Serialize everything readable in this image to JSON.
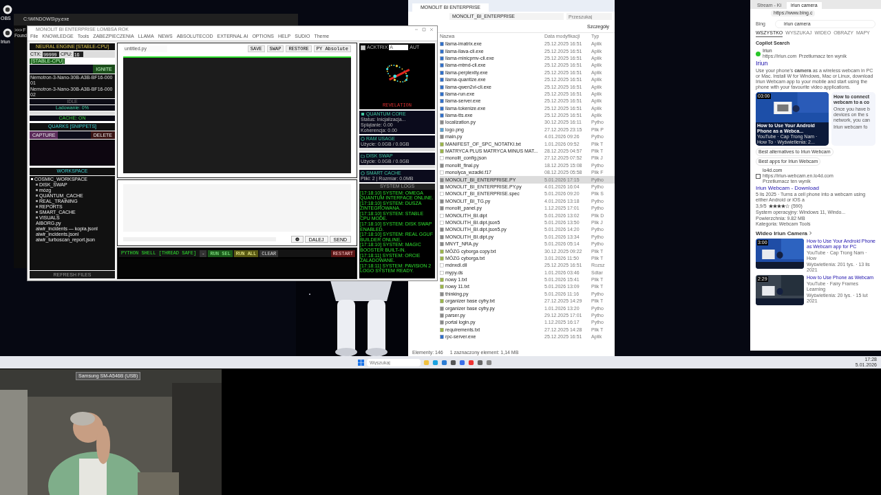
{
  "desktop_icons": [
    {
      "label": "OBS"
    },
    {
      "label": "Iriun"
    }
  ],
  "terminal": {
    "title": "C:\\WINDOWS\\py.exe",
    "lines": [
      ">>> F",
      "Found"
    ]
  },
  "app": {
    "title": "MONOLIT BI ENTERPRISE LOMBSA ROK",
    "menu": [
      "File",
      "KNOWLEDGE",
      "Tools",
      "ZABEZPIECZENIA",
      "LLAMA",
      "NEWS",
      "ABSOLUTECOD",
      "EXTERNAL AI",
      "OPTIONS",
      "HELP",
      "SUDIO",
      "Theme"
    ],
    "engine": {
      "title": "NEURAL ENGINE [STABLE-CPU]",
      "ctx_label": "CTX:",
      "ctx": "99999",
      "cpu_label": "CPU:",
      "cpu": "16",
      "mode": "[STABLE-CPU]",
      "ignite": "IGNITE",
      "models": [
        "Nemotron-3-Nano-30B-A3B-BF16-00001",
        "Nemotron-3-Nano-30B-A3B-BF16-00002"
      ],
      "status": "IDLE",
      "loading": "Ladowanie: 0%",
      "level": 0,
      "cache": "CACHE: ON"
    },
    "quarks": {
      "title": "QUARKS [SNIPPETS]",
      "capture": "CAPTURE",
      "delete": "DELETE"
    },
    "workspace": {
      "title": "WORKSPACE",
      "refresh": "REFRESH FILES",
      "tree": [
        {
          "label": "COSMIC_WORKSPACE",
          "kind": "folder",
          "expanded": true,
          "children": [
            {
              "label": "DISK_SWAP",
              "kind": "folder",
              "expanded": false
            },
            {
              "label": "mózg",
              "kind": "folder",
              "expanded": false
            },
            {
              "label": "QUANTUM_CACHE",
              "kind": "folder",
              "expanded": false
            },
            {
              "label": "REAL_TRAINING",
              "kind": "folder",
              "expanded": false
            },
            {
              "label": "REPORTS",
              "kind": "folder",
              "expanded": false
            },
            {
              "label": "SMART_CACHE",
              "kind": "folder",
              "expanded": false
            },
            {
              "label": "VISUALS",
              "kind": "folder",
              "expanded": false
            },
            {
              "label": "AIBORG.py",
              "kind": "file"
            },
            {
              "label": "aiwir_incidents — kopia.jsonl",
              "kind": "file"
            },
            {
              "label": "aiwir_incidents.jsonl",
              "kind": "file"
            },
            {
              "label": "aiwir_turboscan_report.json",
              "kind": "file"
            }
          ]
        }
      ]
    },
    "editor": {
      "filename": "untitled.py",
      "buttons": [
        "SAVE",
        "SWAP",
        "RESTORE",
        "PY Absolute"
      ]
    },
    "chat": {
      "buttons": [
        "DALEJ",
        "SEND"
      ]
    },
    "shell": {
      "title": "PYTHON SHELL [THREAD SAFE]",
      "buttons": [
        {
          "label": "-",
          "kind": "plain"
        },
        {
          "label": "RUN SEL",
          "kind": "green"
        },
        {
          "label": "RUN ALL",
          "kind": "olive"
        },
        {
          "label": "CLEAR",
          "kind": "plain"
        },
        {
          "label": "RESTART",
          "kind": "red"
        }
      ]
    },
    "visual": {
      "checkbox": {
        "label": "ACKTRIX",
        "checked": true
      },
      "select": "A",
      "auto": "AUT",
      "caption": "REVELATION"
    },
    "cards": [
      {
        "kind": "chip",
        "title": "QUANTUM CORE",
        "lines": [
          "Status: Inicjalizacja...",
          "Splątanie: 0.00",
          "Koherencja: 0.00"
        ]
      },
      {
        "kind": "gauge",
        "title": "RAM USAGE",
        "lines": [
          "Użycie: 0.0GB / 0.0GB"
        ],
        "level": 0
      },
      {
        "kind": "folder",
        "title": "DISK SWAP",
        "lines": [
          "Użycie: 0.0GB / 0.0GB"
        ],
        "level": 0
      },
      {
        "kind": "gauge",
        "title": "SMART CACHE",
        "lines": [
          "Pliki: 2 | Rozmiar: 0.0MB"
        ]
      }
    ],
    "logs": {
      "title": "SYSTEM LOGS",
      "lines": [
        "[17:18:10] SYSTEM: OMEGA QUANTUM INTERFACE ONLINE.",
        "[17:18:10] SYSTEM: DUSZA ZINTEGROWANA.",
        "[17:18:10] SYSTEM: STABLE CPU MODE.",
        "[17:18:10] SYSTEM: DISK SWAP ENABLED.",
        "[17:18:10] SYSTEM: REAL GGUF BUILDER ONLINE.",
        "[17:18:10] SYSTEM: MAGIC BOOSTER BUILT-IN.",
        "[17:18:11] SYSTEM: ORCIE ZALADOWANE.",
        "[17:18:11] SYSTEM: PAVISION 2 LOGO SYSTEM READY."
      ]
    }
  },
  "explorer": {
    "tab": "MONOLIT BI ENTERPRISE",
    "path": "MONOLIT_BI_ENTERPRISE",
    "search": {
      "placeholder": "Przeszukaj"
    },
    "view": "Szczegóły",
    "columns": [
      "Nazwa",
      "Data modyfikacji",
      "Typ"
    ],
    "rows": [
      {
        "name": "llama-imatrix.exe",
        "date": "25.12.2025 16:51",
        "type": "Aplik",
        "kind": "exe",
        "selected": false
      },
      {
        "name": "llama-llava-cli.exe",
        "date": "25.12.2025 16:51",
        "type": "Aplik",
        "kind": "exe",
        "selected": false
      },
      {
        "name": "llama-minicpmv-cli.exe",
        "date": "25.12.2025 16:51",
        "type": "Aplik",
        "kind": "exe",
        "selected": false
      },
      {
        "name": "llama-mtmd-cli.exe",
        "date": "25.12.2025 16:51",
        "type": "Aplik",
        "kind": "exe",
        "selected": false
      },
      {
        "name": "llama-perplexity.exe",
        "date": "25.12.2025 16:51",
        "type": "Aplik",
        "kind": "exe",
        "selected": false
      },
      {
        "name": "llama-quantize.exe",
        "date": "25.12.2025 16:51",
        "type": "Aplik",
        "kind": "exe",
        "selected": false
      },
      {
        "name": "llama-qwen2vl-cli.exe",
        "date": "25.12.2025 16:51",
        "type": "Aplik",
        "kind": "exe",
        "selected": false
      },
      {
        "name": "llama-run.exe",
        "date": "25.12.2025 16:51",
        "type": "Aplik",
        "kind": "exe",
        "selected": false
      },
      {
        "name": "llama-server.exe",
        "date": "25.12.2025 16:51",
        "type": "Aplik",
        "kind": "exe",
        "selected": false
      },
      {
        "name": "llama-tokenize.exe",
        "date": "25.12.2025 16:51",
        "type": "Aplik",
        "kind": "exe",
        "selected": false
      },
      {
        "name": "llama-tts.exe",
        "date": "25.12.2025 16:51",
        "type": "Aplik",
        "kind": "exe",
        "selected": false
      },
      {
        "name": "localization.py",
        "date": "30.12.2025 16:11",
        "type": "Pytho",
        "kind": "py",
        "selected": false
      },
      {
        "name": "logo.png",
        "date": "27.12.2025 23:15",
        "type": "Plik P",
        "selected": false
      },
      {
        "name": "main.py",
        "date": "4.01.2026 09:26",
        "type": "Pytho",
        "kind": "py",
        "selected": false
      },
      {
        "name": "MANIFEST_OF_SPC_NOTATKI.txt",
        "date": "1.01.2026 09:52",
        "type": "Plik T",
        "kind": "txt",
        "selected": false
      },
      {
        "name": "MATRYCA PLUS MATRYCA MINUS MAT...",
        "date": "28.12.2025 04:57",
        "type": "Plik T",
        "kind": "txt",
        "selected": false
      },
      {
        "name": "monolit_config.json",
        "date": "27.12.2025 07:52",
        "type": "Plik J",
        "kind": "file",
        "selected": false
      },
      {
        "name": "monolit_final.py",
        "date": "18.12.2025 15:08",
        "type": "Pytho",
        "kind": "py",
        "selected": false
      },
      {
        "name": "monolyca_wzadki.f17",
        "date": "08.12.2025 05:58",
        "type": "Plik F",
        "kind": "file",
        "selected": false
      },
      {
        "name": "MONOLIT_BI_ENTERPRISE.PY",
        "date": "5.01.2026 17:15",
        "type": "Pytho",
        "kind": "py",
        "selected": true
      },
      {
        "name": "MONOLIT_BI_ENTERPRISE.PY.py",
        "date": "4.01.2026 16:04",
        "type": "Pytho",
        "kind": "py",
        "selected": false
      },
      {
        "name": "MONOLIT_BI_ENTERPRISE.spec",
        "date": "5.01.2026 09:20",
        "type": "Plik S",
        "kind": "file",
        "selected": false
      },
      {
        "name": "MONOLIT_BI_TG.py",
        "date": "4.01.2026 13:18",
        "type": "Pytho",
        "kind": "py",
        "selected": false
      },
      {
        "name": "monolit_panel.py",
        "date": "1.12.2025 17:01",
        "type": "Pytho",
        "kind": "py",
        "selected": false
      },
      {
        "name": "MONOLITH_BI.dipt",
        "date": "5.01.2026 13:02",
        "type": "Plik D",
        "kind": "file",
        "selected": false
      },
      {
        "name": "MONOLITH_BI.dipt.json5",
        "date": "5.01.2026 13:50",
        "type": "Plik J",
        "kind": "file",
        "selected": false
      },
      {
        "name": "MONOLITH_BI.dipt.json5.py",
        "date": "5.01.2026 14:20",
        "type": "Pytho",
        "kind": "py",
        "selected": false
      },
      {
        "name": "MONOLITH_BI.dipt.py",
        "date": "5.01.2026 13:34",
        "type": "Pytho",
        "kind": "py",
        "selected": false
      },
      {
        "name": "MNYT_NRA.py",
        "date": "5.01.2026 05:14",
        "type": "Pytho",
        "kind": "py",
        "selected": false
      },
      {
        "name": "MÓZG cyborga copy.txt",
        "date": "30.12.2025 09:22",
        "type": "Plik T",
        "kind": "txt",
        "selected": false
      },
      {
        "name": "MÓZG cyborga.txt",
        "date": "3.01.2026 11:50",
        "type": "Plik T",
        "kind": "txt",
        "selected": false
      },
      {
        "name": "mdnxdl.dll",
        "date": "25.12.2025 16:51",
        "type": "Rozsz",
        "kind": "file",
        "selected": false
      },
      {
        "name": "mypy.ds",
        "date": "1.01.2026 03:46",
        "type": "Sdtar",
        "kind": "file",
        "selected": false
      },
      {
        "name": "nowy 1.txt",
        "date": "5.01.2026 15:41",
        "type": "Plik T",
        "kind": "txt",
        "selected": false
      },
      {
        "name": "nowy 11.txt",
        "date": "5.01.2026 13:09",
        "type": "Plik T",
        "kind": "txt",
        "selected": false
      },
      {
        "name": "thinking.py",
        "date": "5.01.2026 11:16",
        "type": "Pytho",
        "kind": "py",
        "selected": false
      },
      {
        "name": "organizer base cyfry.txt",
        "date": "27.12.2025 14:29",
        "type": "Plik T",
        "kind": "txt",
        "selected": false
      },
      {
        "name": "organizer base cyfry.py",
        "date": "1.01.2026 13:20",
        "type": "Pytho",
        "kind": "py",
        "selected": false
      },
      {
        "name": "parser.py",
        "date": "29.12.2025 17:01",
        "type": "Pytho",
        "kind": "py",
        "selected": false
      },
      {
        "name": "portal login.py",
        "date": "1.12.2025 16:17",
        "type": "Pytho",
        "kind": "py",
        "selected": false
      },
      {
        "name": "requirements.txt",
        "date": "27.12.2025 14:28",
        "type": "Plik T",
        "kind": "txt",
        "selected": false
      },
      {
        "name": "rpc-server.exe",
        "date": "25.12.2025 16:51",
        "type": "Aplik",
        "kind": "exe",
        "selected": false
      }
    ],
    "status": [
      "Elementy: 146",
      "1 zaznaczony element: 1,14 MB"
    ]
  },
  "browser": {
    "tabs": [
      {
        "label": "Stream - Ki",
        "selected": false
      },
      {
        "label": "iriun camera",
        "selected": true
      }
    ],
    "url": "https://www.bing.c",
    "engine": "Bing",
    "query": "iriun camera",
    "nav": [
      {
        "label": "WSZYSTKO",
        "selected": true
      },
      {
        "label": "WYSZUKAJ",
        "selected": false
      },
      {
        "label": "WIDEO",
        "selected": false
      },
      {
        "label": "OBRAZY",
        "selected": false
      },
      {
        "label": "MAPY",
        "selected": false
      }
    ],
    "copilot": "Copilot Search",
    "result1": {
      "site": "Iriun",
      "url": "https://iriun.com",
      "translate": "Przetłumacz ten wynik",
      "title": "Iriun",
      "snippet": "Use your phone's **camera** as a wireless webcam in PC or Mac. Install W for Windows, Mac or Linux, download Iriun Webcam app to your mobile and start using the phone with your favourite video applications."
    },
    "video": {
      "duration": "03:00",
      "caption": "How to Use Your Android Phone as a Webca...",
      "source": "YouTube · Cap Trong Nam · How To · Wyświetlenia: 2..."
    },
    "side_card": {
      "title": "How to connect webcam to a co",
      "body": "Once you have b devices on the s network, you can",
      "link": "Iriun webcam fo"
    },
    "chips": [
      "Best alternatives to Iriun Webcam",
      "Best apps for Iriun Webcam"
    ],
    "result2": {
      "site": "lo4d.com",
      "url": "https://iriun-webcam.en.lo4d.com",
      "translate": "Przetłumacz ten wynik",
      "title": "Iriun Webcam - Download",
      "snippet": "5 lis 2025 · Turns a cell phone into a webcam using either Android or iOS a",
      "rating": "3,9/5",
      "stars": 4,
      "count": "(590)",
      "facts": [
        "System operacyjny: Windows 11, Windo...",
        "Powierzchnia: 9.82 MB",
        "Kategoria: Webcam Tools"
      ]
    },
    "videos_title": "Wideo Iriun Camera",
    "videos": [
      {
        "duration": "3:00",
        "title": "How to Use Your Android Phone as Webcam app for PC",
        "source": "YouTube · Cap Trong Nam · How",
        "meta": "Wyświetlenia: 201 tys. · 13 lis 2021"
      },
      {
        "duration": "2:29",
        "title": "How to Use Phone as Webcam",
        "source": "YouTube · Fairy Frames Learning",
        "meta": "Wyświetlenia: 20 tys. · 15 lut 2021"
      }
    ]
  },
  "taskbar": {
    "search": {
      "placeholder": "Wyszukaj"
    },
    "clock": [
      "17:28",
      "5.01.2026"
    ]
  },
  "webcam": {
    "label": "Samsung SM-A546B (USB)"
  }
}
